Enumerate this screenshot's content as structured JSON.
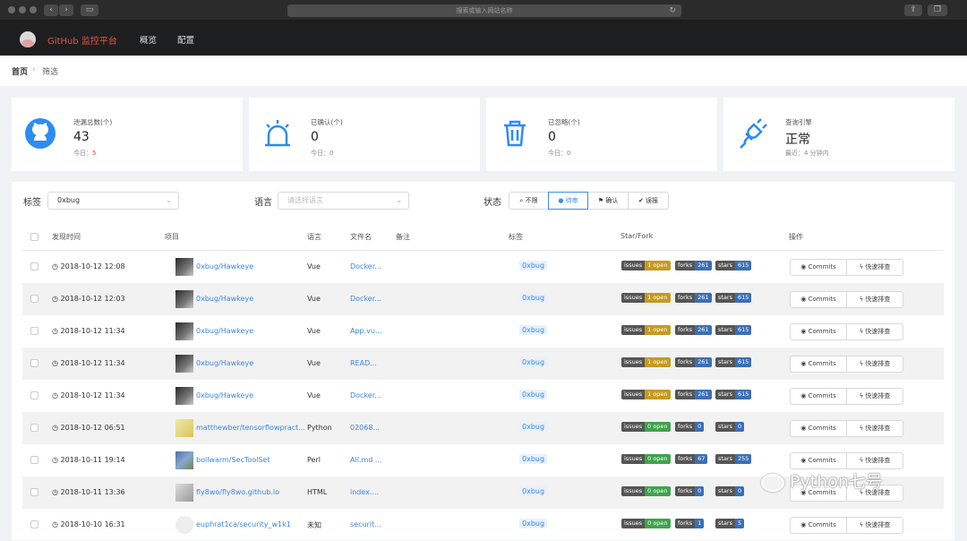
{
  "browser": {
    "url_placeholder": "搜索或输入网站名称",
    "reload_icon": "reload-icon",
    "tab_icon": "sidebar-icon"
  },
  "nav": {
    "brand": "GitHub 监控平台",
    "items": [
      "概览",
      "配置"
    ]
  },
  "breadcrumb": {
    "home": "首页",
    "sep": "›",
    "current": "筛选"
  },
  "stats": [
    {
      "label": "泄漏总数(个)",
      "value": "43",
      "sub_prefix": "今日：",
      "sub_value": "5",
      "icon": "github-icon"
    },
    {
      "label": "已确认(个)",
      "value": "0",
      "sub_prefix": "今日：",
      "sub_value": "0",
      "icon": "alarm-icon"
    },
    {
      "label": "已忽略(个)",
      "value": "0",
      "sub_prefix": "今日：",
      "sub_value": "0",
      "icon": "trash-icon"
    },
    {
      "label": "查询引擎",
      "value": "正常",
      "sub_prefix": "最近：",
      "sub_value": "4 分钟内",
      "icon": "plug-icon"
    }
  ],
  "filters": {
    "tag_label": "标签",
    "tag_value": "0xbug",
    "lang_label": "语言",
    "lang_placeholder": "请选择语言",
    "status_label": "状态",
    "status_options": [
      "不限",
      "待审",
      "确认",
      "误报"
    ],
    "status_active": 1
  },
  "table": {
    "headers": [
      "发现时间",
      "项目",
      "语言",
      "文件名",
      "备注",
      "标签",
      "Star/Fork",
      "操作"
    ],
    "rows": [
      {
        "time": "2018-10-12 12:08",
        "project": "0xbug/Hawkeye",
        "lang": "Vue",
        "file": "Docker...",
        "tag": "0xbug",
        "issues": "1 open",
        "forks": "261",
        "stars": "615",
        "iss_color": "#c59a1f",
        "av": ""
      },
      {
        "time": "2018-10-12 12:03",
        "project": "0xbug/Hawkeye",
        "lang": "Vue",
        "file": "Docker...",
        "tag": "0xbug",
        "issues": "1 open",
        "forks": "261",
        "stars": "615",
        "iss_color": "#c59a1f",
        "av": ""
      },
      {
        "time": "2018-10-12 11:34",
        "project": "0xbug/Hawkeye",
        "lang": "Vue",
        "file": "App.vu...",
        "tag": "0xbug",
        "issues": "1 open",
        "forks": "261",
        "stars": "615",
        "iss_color": "#c59a1f",
        "av": ""
      },
      {
        "time": "2018-10-12 11:34",
        "project": "0xbug/Hawkeye",
        "lang": "Vue",
        "file": "READ...",
        "tag": "0xbug",
        "issues": "1 open",
        "forks": "261",
        "stars": "615",
        "iss_color": "#c59a1f",
        "av": ""
      },
      {
        "time": "2018-10-12 11:34",
        "project": "0xbug/Hawkeye",
        "lang": "Vue",
        "file": "Docker...",
        "tag": "0xbug",
        "issues": "1 open",
        "forks": "261",
        "stars": "615",
        "iss_color": "#c59a1f",
        "av": ""
      },
      {
        "time": "2018-10-12 06:51",
        "project": "matthewber/tensorflowpract...",
        "lang": "Python",
        "file": "02068...",
        "tag": "0xbug",
        "issues": "0 open",
        "forks": "0",
        "stars": "0",
        "iss_color": "#3fa34d",
        "av": "a2"
      },
      {
        "time": "2018-10-11 19:14",
        "project": "bollwarm/SecToolSet",
        "lang": "Perl",
        "file": "All.md ...",
        "tag": "0xbug",
        "issues": "0 open",
        "forks": "67",
        "stars": "255",
        "iss_color": "#3fa34d",
        "av": "a3"
      },
      {
        "time": "2018-10-11 13:36",
        "project": "fly8wo/fly8wo.github.io",
        "lang": "HTML",
        "file": "index....",
        "tag": "0xbug",
        "issues": "0 open",
        "forks": "0",
        "stars": "0",
        "iss_color": "#3fa34d",
        "av": "a4"
      },
      {
        "time": "2018-10-10 16:31",
        "project": "euphrat1ca/security_w1k1",
        "lang": "未知",
        "file": "securit...",
        "tag": "0xbug",
        "issues": "0 open",
        "forks": "1",
        "stars": "5",
        "iss_color": "#3fa34d",
        "av": "a5"
      }
    ],
    "shield_keys": {
      "issues": "issues",
      "forks": "forks",
      "stars": "stars"
    },
    "fork_color": "#3b6fb6",
    "commits_label": "Commits",
    "quick_label": "快速排查"
  },
  "watermark": "Python七号"
}
